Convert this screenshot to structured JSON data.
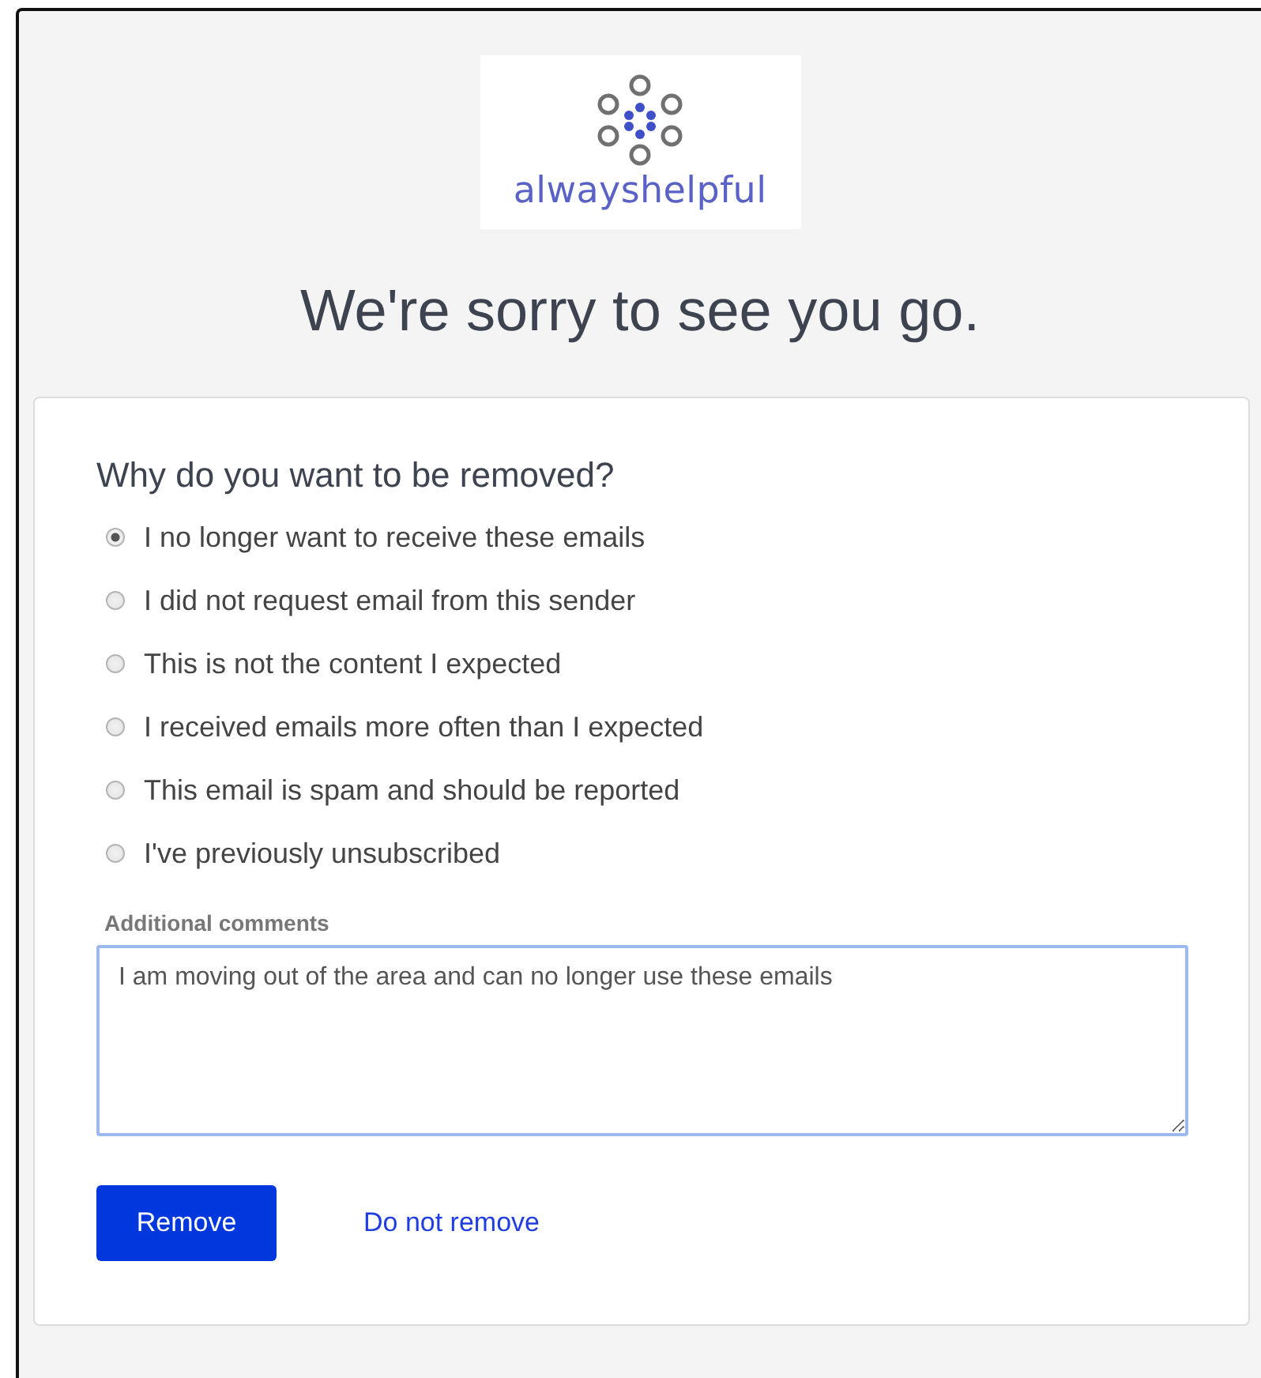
{
  "logo": {
    "text": "alwayshelpful"
  },
  "title": "We're sorry to see you go.",
  "form": {
    "question": "Why do you want to be removed?",
    "reasons": [
      {
        "label": "I no longer want to receive these emails",
        "selected": true
      },
      {
        "label": "I did not request email from this sender",
        "selected": false
      },
      {
        "label": "This is not the content I expected",
        "selected": false
      },
      {
        "label": "I received emails more often than I expected",
        "selected": false
      },
      {
        "label": "This email is spam and should be reported",
        "selected": false
      },
      {
        "label": "I've previously unsubscribed",
        "selected": false
      }
    ],
    "comments": {
      "label": "Additional comments",
      "value": "I am moving out of the area and can no longer use these emails"
    },
    "buttons": [
      {
        "kind": "primary",
        "label": "Remove"
      },
      {
        "kind": "link",
        "label": "Do not remove"
      }
    ]
  }
}
